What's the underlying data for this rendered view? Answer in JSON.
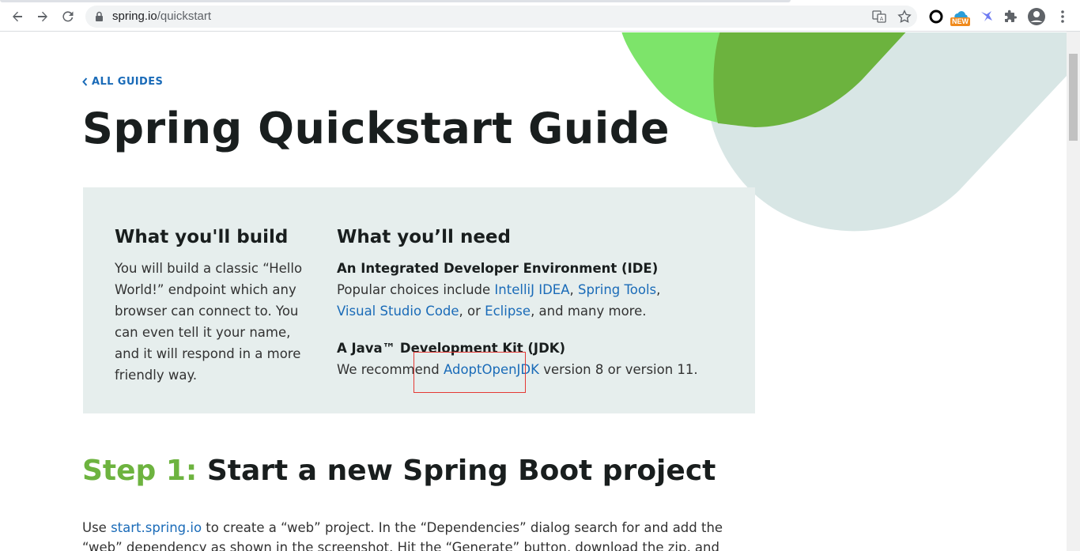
{
  "browser": {
    "url_host": "spring.io",
    "url_path": "/quickstart",
    "new_badge": "NEW"
  },
  "nav": {
    "back_label": "ALL GUIDES"
  },
  "page_title": "Spring Quickstart Guide",
  "build": {
    "heading": "What you'll build",
    "text": "You will build a classic “Hello World!” endpoint which any browser can connect to. You can even tell it your name, and it will respond in a more friendly way."
  },
  "need": {
    "heading": "What you’ll need",
    "ide": {
      "title": "An Integrated Developer Environment (IDE)",
      "prefix": "Popular choices include ",
      "link1": "IntelliJ IDEA",
      "sep1": ", ",
      "link2": "Spring Tools",
      "sep2": ", ",
      "link3": "Visual Studio Code",
      "sep3": ", or ",
      "link4": "Eclipse",
      "suffix": ", and many more."
    },
    "jdk": {
      "title": "A Java™ Development Kit (JDK)",
      "prefix": "We recommend ",
      "link": "AdoptOpenJDK",
      "suffix": " version 8 or version 11."
    }
  },
  "step1": {
    "number": "Step 1:",
    "title": " Start a new Spring Boot project",
    "use": "Use ",
    "link": "start.spring.io",
    "text": " to create a “web” project. In the “Dependencies” dialog search for and add the “web” dependency as shown in the screenshot. Hit the “Generate” button, download the zip, and unpack it into a folder"
  },
  "colors": {
    "spring_green": "#6db33f",
    "link_blue": "#1a6bb8",
    "panel_bg": "#e6eeed"
  }
}
